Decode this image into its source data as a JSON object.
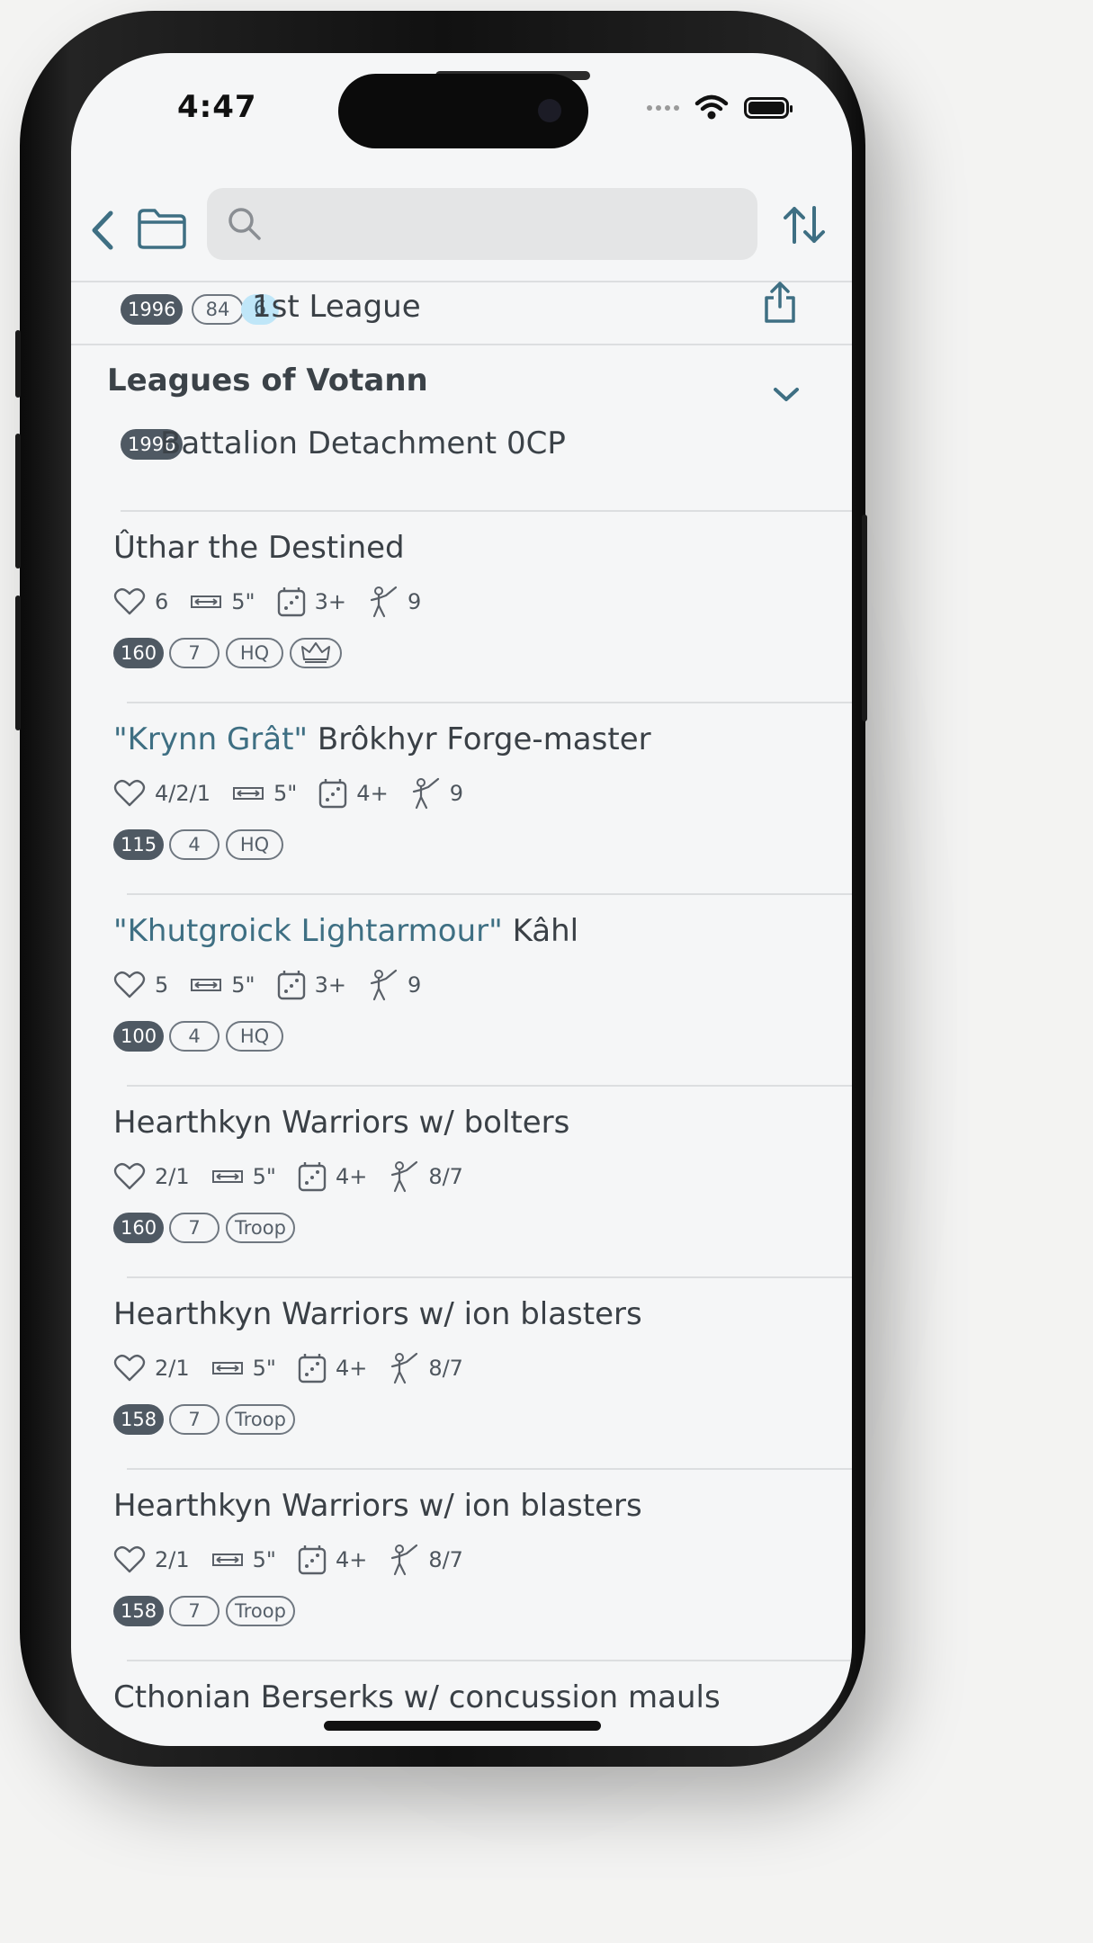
{
  "status_bar": {
    "time": "4:47"
  },
  "search": {
    "placeholder": ""
  },
  "league": {
    "points": "1996",
    "count": "84",
    "cp": "6",
    "title": "1st League"
  },
  "section": {
    "title": "Leagues of Votann",
    "points": "1996",
    "detachment": "Battalion Detachment 0CP"
  },
  "units": [
    {
      "nickname": "",
      "name": "Ûthar the Destined",
      "wounds": "6",
      "move": "5\"",
      "save": "3+",
      "leadership": "9",
      "points": "160",
      "power": "7",
      "role": "HQ",
      "warlord": true
    },
    {
      "nickname": "\"Krynn Grât\"",
      "name": "Brôkhyr Forge-master",
      "wounds": "4/2/1",
      "move": "5\"",
      "save": "4+",
      "leadership": "9",
      "points": "115",
      "power": "4",
      "role": "HQ",
      "warlord": false
    },
    {
      "nickname": "\"Khutgroick Lightarmour\"",
      "name": "Kâhl",
      "wounds": "5",
      "move": "5\"",
      "save": "3+",
      "leadership": "9",
      "points": "100",
      "power": "4",
      "role": "HQ",
      "warlord": false
    },
    {
      "nickname": "",
      "name": "Hearthkyn Warriors w/ bolters",
      "wounds": "2/1",
      "move": "5\"",
      "save": "4+",
      "leadership": "8/7",
      "points": "160",
      "power": "7",
      "role": "Troop",
      "warlord": false
    },
    {
      "nickname": "",
      "name": "Hearthkyn Warriors w/ ion blasters",
      "wounds": "2/1",
      "move": "5\"",
      "save": "4+",
      "leadership": "8/7",
      "points": "158",
      "power": "7",
      "role": "Troop",
      "warlord": false
    },
    {
      "nickname": "",
      "name": "Hearthkyn Warriors w/ ion blasters",
      "wounds": "2/1",
      "move": "5\"",
      "save": "4+",
      "leadership": "8/7",
      "points": "158",
      "power": "7",
      "role": "Troop",
      "warlord": false
    },
    {
      "nickname": "",
      "name": "Cthonian Berserks w/ concussion mauls"
    }
  ],
  "colors": {
    "accent": "#3e6f83",
    "pill_dark": "#4f5963",
    "pill_blue": "#bfe6f8"
  },
  "icons": [
    "back-icon",
    "folder-icon",
    "search-icon",
    "sort-icon",
    "share-icon",
    "chevron-down-icon",
    "heart-icon",
    "move-icon",
    "dice-icon",
    "leadership-icon",
    "crown-icon",
    "wifi-icon",
    "battery-icon"
  ]
}
